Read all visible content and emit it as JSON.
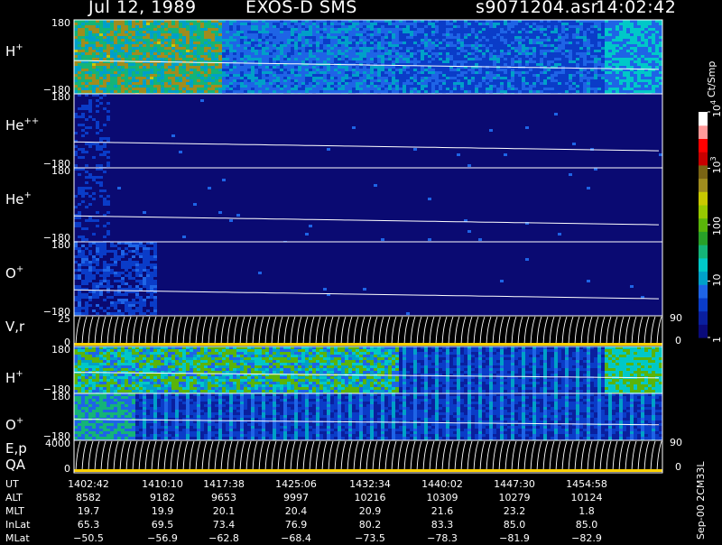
{
  "header": {
    "date": "Jul 12, 1989",
    "instrument": "EXOS-D SMS",
    "filename": "s9071204.asr",
    "time": "14:02:42"
  },
  "colorbar": {
    "unit": "Ct/Smp",
    "tick_labels": [
      "1",
      "10",
      "100",
      "10",
      "10"
    ],
    "tick_exponents": [
      "",
      "",
      "",
      "3",
      "4"
    ],
    "colors": [
      "#0a0a7a",
      "#0a1f9e",
      "#0a3cc8",
      "#1e64e6",
      "#00a0c8",
      "#00c8c8",
      "#14b478",
      "#28a028",
      "#5ab40a",
      "#96c800",
      "#c8c800",
      "#a08c1e",
      "#7a6414",
      "#c80000",
      "#ff0000",
      "#ff9a9a",
      "#ffffff"
    ]
  },
  "footer_code": "Sep-00 2CM33L",
  "panels": [
    {
      "label_base": "H",
      "label_sup": "+",
      "y_top": "180",
      "y_bottom": "−180"
    },
    {
      "label_base": "He",
      "label_sup": "++",
      "y_top": "180",
      "y_bottom": "−180"
    },
    {
      "label_base": "He",
      "label_sup": "+",
      "y_top": "180",
      "y_bottom": "−180"
    },
    {
      "label_base": "O",
      "label_sup": "+",
      "y_top": "180",
      "y_bottom": "−180"
    },
    {
      "label_base": "V,r",
      "label_sup": "",
      "y_top": "25",
      "y_bottom": "0",
      "right_top": "90",
      "right_bottom": "0"
    },
    {
      "label_base": "H",
      "label_sup": "+",
      "y_top": "180",
      "y_bottom": "−180"
    },
    {
      "label_base": "O",
      "label_sup": "+",
      "y_top": "180",
      "y_bottom": "−180"
    },
    {
      "label_base": "E,p",
      "label_line2": "QA",
      "label_sup": "",
      "y_top": "4000",
      "y_bottom": "0",
      "right_top": "90",
      "right_bottom": "0"
    }
  ],
  "chart_data": {
    "type": "heatmap",
    "title": "Jul 12, 1989   EXOS-D SMS",
    "colorbar_unit": "Ct/Smp",
    "colorbar_range": [
      1,
      10000
    ],
    "colorbar_scale": "log",
    "y_range": [
      -180,
      180
    ],
    "panels": [
      "H+",
      "He++",
      "He+",
      "O+",
      "V,r",
      "H+",
      "O+",
      "E,p QA"
    ],
    "x_ticks_UT": [
      "1402:42",
      "1410:10",
      "1417:38",
      "1425:06",
      "1432:34",
      "1440:02",
      "1447:30",
      "1454:58"
    ],
    "ephemeris": [
      {
        "name": "UT",
        "values": [
          "1402:42",
          "1410:10",
          "1417:38",
          "1425:06",
          "1432:34",
          "1440:02",
          "1447:30",
          "1454:58"
        ]
      },
      {
        "name": "ALT",
        "values": [
          "8582",
          "9182",
          "9653",
          "9997",
          "10216",
          "10309",
          "10279",
          "10124"
        ]
      },
      {
        "name": "MLT",
        "values": [
          "19.7",
          "19.9",
          "20.1",
          "20.4",
          "20.9",
          "21.6",
          "23.2",
          "1.8"
        ]
      },
      {
        "name": "InLat",
        "values": [
          "65.3",
          "69.5",
          "73.4",
          "76.9",
          "80.2",
          "83.3",
          "85.0",
          "85.0"
        ]
      },
      {
        "name": "MLat",
        "values": [
          "−50.5",
          "−56.9",
          "−62.8",
          "−68.4",
          "−73.5",
          "−78.3",
          "−81.9",
          "−82.9"
        ]
      }
    ]
  }
}
